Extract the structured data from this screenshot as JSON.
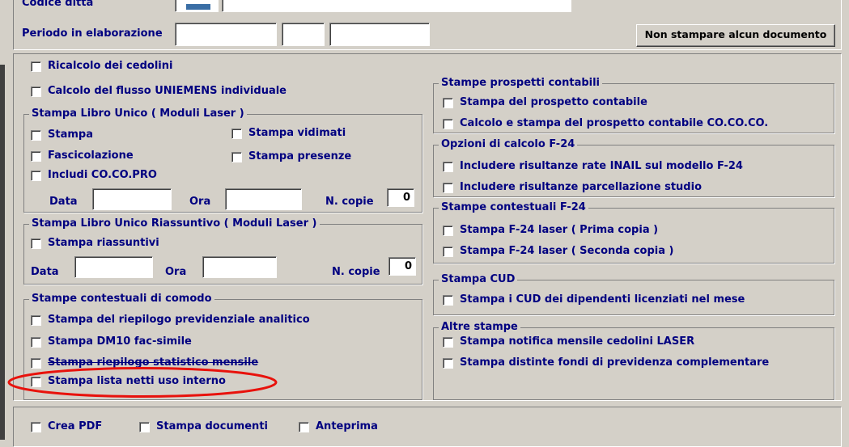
{
  "header": {
    "codice_ditta_label": "Codice ditta",
    "periodo_label": "Periodo in elaborazione",
    "non_stampare_button": "Non stampare alcun documento"
  },
  "left": {
    "ricalcolo": "Ricalcolo dei cedolini",
    "calcolo_uniemens": "Calcolo del flusso UNIEMENS individuale",
    "libro_unico": {
      "title": "Stampa Libro Unico ( Moduli Laser )",
      "stampa": "Stampa",
      "stampa_vidimati": "Stampa vidimati",
      "fascicolazione": "Fascicolazione",
      "stampa_presenze": "Stampa presenze",
      "includi_cocopro": "Includi CO.CO.PRO",
      "data_label": "Data",
      "ora_label": "Ora",
      "ncopie_label": "N. copie",
      "ncopie_value": "0"
    },
    "libro_riassuntivo": {
      "title": "Stampa Libro Unico Riassuntivo ( Moduli Laser )",
      "stampa_riassuntivi": "Stampa riassuntivi",
      "data_label": "Data",
      "ora_label": "Ora",
      "ncopie_label": "N. copie",
      "ncopie_value": "0"
    },
    "contestuali_comodo": {
      "title": "Stampe contestuali di comodo",
      "riepilogo_prev": "Stampa del riepilogo previdenziale analitico",
      "dm10": "Stampa DM10 fac-simile",
      "riepilogo_stat": "Stampa riepilogo statistico mensile",
      "lista_netti": "Stampa lista netti uso interno"
    }
  },
  "right": {
    "prospetti": {
      "title": "Stampe prospetti contabili",
      "stampa_prospetto": "Stampa del prospetto contabile",
      "calcolo_cococo": "Calcolo e stampa del prospetto contabile CO.CO.CO."
    },
    "opzioni_f24": {
      "title": "Opzioni di calcolo F-24",
      "inail": "Includere risultanze rate INAIL sul modello F-24",
      "parcellazione": "Includere risultanze parcellazione studio"
    },
    "contestuali_f24": {
      "title": "Stampe contestuali F-24",
      "prima_copia": "Stampa F-24 laser ( Prima copia )",
      "seconda_copia": "Stampa F-24 laser ( Seconda copia )"
    },
    "cud": {
      "title": "Stampa CUD",
      "stampa_cud": "Stampa i CUD dei dipendenti licenziati nel mese"
    },
    "altre": {
      "title": "Altre stampe",
      "notifica": "Stampa notifica mensile cedolini LASER",
      "distinte": "Stampa distinte fondi di previdenza complementare"
    }
  },
  "bottom": {
    "crea_pdf": "Crea PDF",
    "stampa_documenti": "Stampa documenti",
    "anteprima": "Anteprima"
  },
  "colors": {
    "background": "#d4d0c8",
    "label_text": "#000080",
    "annotation_ellipse": "#e8120c"
  }
}
